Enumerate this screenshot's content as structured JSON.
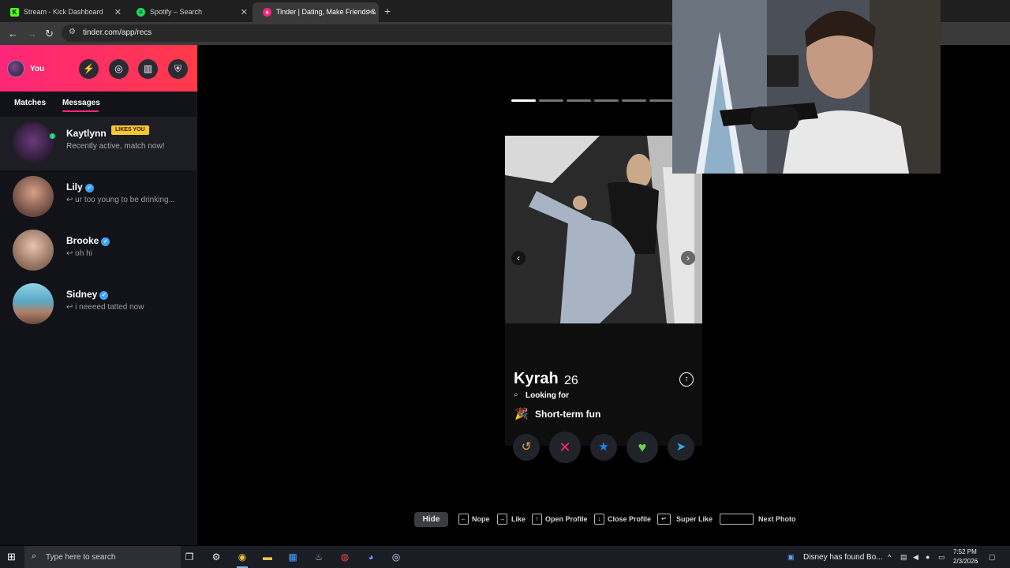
{
  "browser": {
    "tabs": [
      {
        "title": "Stream - Kick Dashboard",
        "favicon": "kick-icon",
        "color": "#53fc18"
      },
      {
        "title": "Spotify – Search",
        "favicon": "spotify-icon",
        "color": "#1ed760"
      },
      {
        "title": "Tinder | Dating, Make Friends &",
        "favicon": "tinder-icon",
        "color": "#fd267a",
        "active": true
      }
    ],
    "url": "tinder.com/app/recs"
  },
  "sidebar": {
    "you_label": "You",
    "tabs": [
      "Matches",
      "Messages"
    ],
    "active_tab": "Messages",
    "conversations": [
      {
        "name": "Kaytlynn",
        "badge": "LIKES YOU",
        "preview": "Recently active, match now!"
      },
      {
        "name": "Lily",
        "verified": true,
        "preview": "ur too young to be drinking..."
      },
      {
        "name": "Brooke",
        "verified": true,
        "preview": "oh hi"
      },
      {
        "name": "Sidney",
        "verified": true,
        "preview": "i neeeed tatted now"
      }
    ]
  },
  "card": {
    "name": "Kyrah",
    "age": "26",
    "looking_for_label": "Looking for",
    "relationship_goal": "Short-term fun",
    "photo_count": 6,
    "current_photo": 1
  },
  "actions": [
    {
      "name": "rewind-icon",
      "glyph": "↺",
      "color": "#f5a623"
    },
    {
      "name": "nope-icon",
      "glyph": "✕",
      "color": "#fd267a"
    },
    {
      "name": "super-like-icon",
      "glyph": "★",
      "color": "#1786ff"
    },
    {
      "name": "like-icon",
      "glyph": "♥",
      "color": "#6bd34a"
    },
    {
      "name": "boost-icon",
      "glyph": "➤",
      "color": "#2fa6e8"
    }
  ],
  "legend": {
    "hide": "Hide",
    "items": [
      "Nope",
      "Like",
      "Open Profile",
      "Close Profile",
      "Super Like",
      "Next Photo"
    ]
  },
  "taskbar": {
    "search_placeholder": "Type here to search",
    "notification": "Disney has found Bo...",
    "time": "7:52 PM",
    "date": "2/3/2026"
  }
}
